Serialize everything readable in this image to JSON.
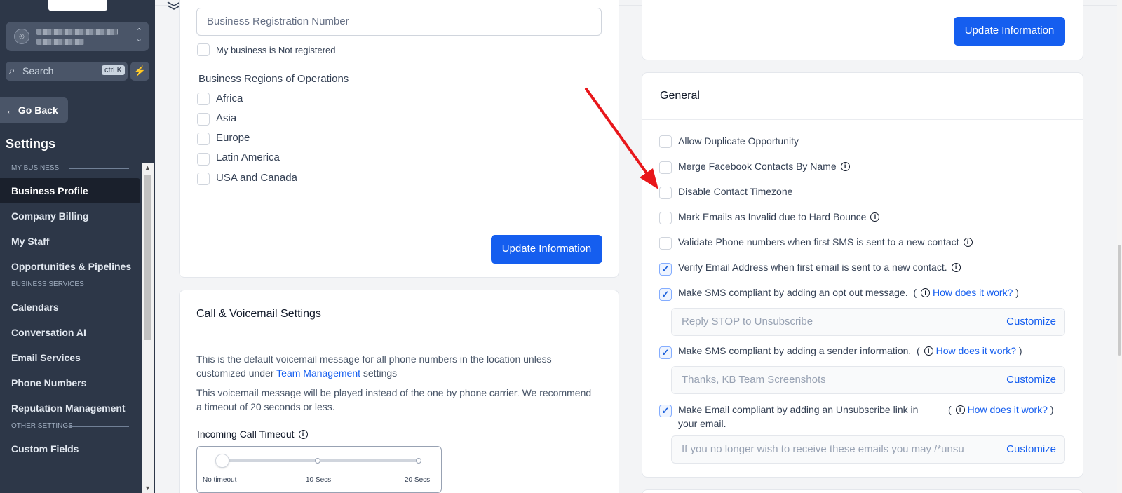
{
  "sidebar": {
    "search_placeholder": "Search",
    "search_shortcut": "ctrl K",
    "go_back": "Go Back",
    "title": "Settings",
    "sections": {
      "my_business": "MY BUSINESS",
      "business_services": "BUSINESS SERVICES",
      "other_settings": "OTHER SETTINGS"
    },
    "items": {
      "business_profile": "Business Profile",
      "company_billing": "Company Billing",
      "my_staff": "My Staff",
      "opportunities": "Opportunities & Pipelines",
      "calendars": "Calendars",
      "conversation_ai": "Conversation AI",
      "email_services": "Email Services",
      "phone_numbers": "Phone Numbers",
      "reputation": "Reputation Management",
      "custom_fields": "Custom Fields"
    },
    "active_item": "Business Profile"
  },
  "business_info": {
    "registration_placeholder": "Business Registration Number",
    "not_registered_label": "My business is Not registered",
    "regions_label": "Business Regions of Operations",
    "regions": [
      "Africa",
      "Asia",
      "Europe",
      "Latin America",
      "USA and Canada"
    ],
    "update_button": "Update Information"
  },
  "call_voicemail": {
    "title": "Call & Voicemail Settings",
    "desc_prefix": "This is the default voicemail message for all phone numbers in the location unless customized under",
    "desc_link": "Team Management",
    "desc_suffix": "settings",
    "desc2": "This voicemail message will be played instead of the one by phone carrier. We recommend a timeout of 20 seconds or less.",
    "timeout_label": "Incoming Call Timeout",
    "slider_ticks": [
      "No timeout",
      "10 Secs",
      "20 Secs"
    ],
    "slider_value": 0
  },
  "top_right": {
    "update_button": "Update Information"
  },
  "general": {
    "title": "General",
    "options": {
      "allow_duplicate": "Allow Duplicate Opportunity",
      "merge_facebook": "Merge Facebook Contacts By Name",
      "disable_timezone": "Disable Contact Timezone",
      "mark_invalid": "Mark Emails as Invalid due to Hard Bounce",
      "validate_phone": "Validate Phone numbers when first SMS is sent to a new contact",
      "verify_email": "Verify Email Address when first email is sent to a new contact.",
      "sms_opt_out": "Make SMS compliant by adding an opt out message.",
      "sms_sender": "Make SMS compliant by adding a sender information.",
      "email_unsub_1": "Make Email compliant by adding an Unsubscribe link in",
      "email_unsub_2": "your email."
    },
    "how_link": "How does it work?",
    "opt_out_placeholder": "Reply STOP to Unsubscribe",
    "sender_placeholder": "Thanks, KB Team Screenshots",
    "unsub_placeholder": "If you no longer wish to receive these emails you may /*unsu",
    "customize": "Customize",
    "checked": {
      "verify_email": true,
      "sms_opt_out": true,
      "sms_sender": true,
      "email_unsub": true
    }
  },
  "colors": {
    "primary": "#155eef",
    "sidebar_bg": "#2d3748",
    "annotation_arrow": "#e8171b"
  }
}
